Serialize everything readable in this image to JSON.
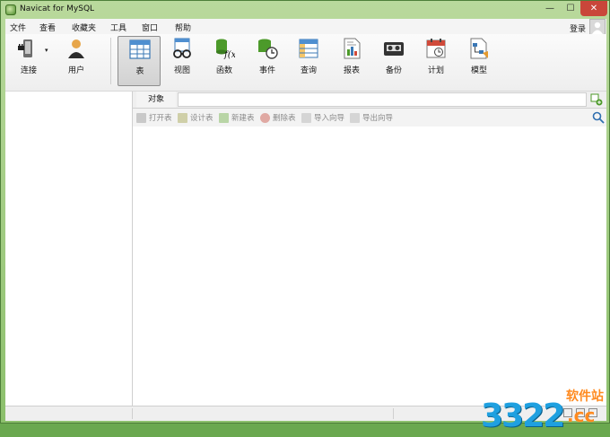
{
  "window": {
    "title": "Navicat for MySQL",
    "min_glyph": "—",
    "max_glyph": "☐",
    "close_glyph": "✕"
  },
  "menu": [
    "文件",
    "查看",
    "收藏夹",
    "工具",
    "窗口",
    "帮助"
  ],
  "account": {
    "login_label": "登录"
  },
  "toolbar": {
    "connect": "连接",
    "user": "用户",
    "table": "表",
    "view": "视图",
    "function": "函数",
    "event": "事件",
    "query": "查询",
    "report": "报表",
    "backup": "备份",
    "schedule": "计划",
    "model": "模型",
    "active": "table"
  },
  "object_tab": {
    "label": "对象",
    "search_value": ""
  },
  "object_actions": [
    "打开表",
    "设计表",
    "新建表",
    "删除表",
    "导入向导",
    "导出向导"
  ],
  "watermark": {
    "site_cn": "软件站",
    "number": "3322",
    "domain": ".cc"
  },
  "colors": {
    "frame": "#8cc06c",
    "close": "#c9463a",
    "watermark_blue": "#1fa0e0",
    "watermark_orange": "#ff8a1f"
  }
}
